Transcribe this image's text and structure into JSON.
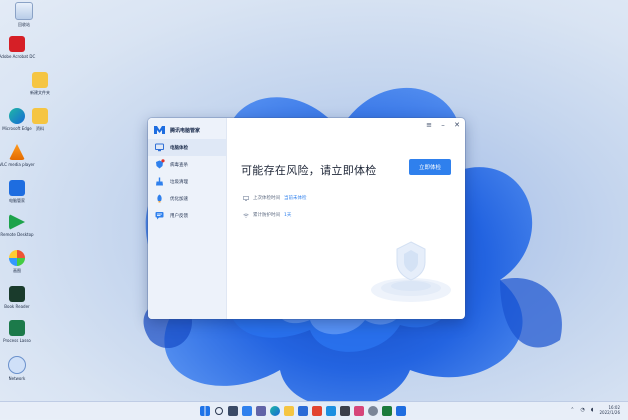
{
  "desktop": {
    "icons": [
      {
        "name": "recycle-bin",
        "label": "回收站"
      },
      {
        "name": "adobe-acrobat",
        "label": "Adobe Acrobat DC"
      },
      {
        "name": "folder",
        "label": "新建文件夹"
      },
      {
        "name": "microsoft-edge",
        "label": "Microsoft Edge"
      },
      {
        "name": "folder",
        "label": "资料"
      },
      {
        "name": "vlc-player",
        "label": "VLC media player"
      },
      {
        "name": "pc-manager",
        "label": "电脑管家"
      },
      {
        "name": "remote-desktop",
        "label": "Remote Desktop"
      },
      {
        "name": "drawing-app",
        "label": "画图"
      },
      {
        "name": "ebook-reader",
        "label": "Book Reader"
      },
      {
        "name": "performance-meter",
        "label": "Process Lasso"
      },
      {
        "name": "network-app",
        "label": "Network"
      }
    ]
  },
  "app": {
    "title": "腾讯电脑管家",
    "window_controls": {
      "menu": "≡",
      "minimize": "–",
      "close": "✕"
    },
    "nav": [
      {
        "label": "电脑体检",
        "icon": "monitor-icon",
        "active": true
      },
      {
        "label": "病毒查杀",
        "icon": "shield-virus-icon",
        "badge": true
      },
      {
        "label": "垃圾清理",
        "icon": "broom-icon"
      },
      {
        "label": "优化加速",
        "icon": "rocket-icon"
      },
      {
        "label": "用户反馈",
        "icon": "feedback-icon"
      }
    ],
    "headline": "可能存在风险，请立即体检",
    "cta_label": "立即体检",
    "info": [
      {
        "label": "上次体检时间",
        "value": "当前未体检",
        "icon": "monitor-icon"
      },
      {
        "label": "累计防护时间",
        "value": "1天",
        "icon": "wifi-icon"
      }
    ]
  },
  "taskbar": {
    "icons": [
      "windows-start-icon",
      "search-icon",
      "task-view-icon",
      "widgets-icon",
      "chat-icon",
      "edge-icon",
      "file-explorer-icon",
      "store-icon",
      "office-icon",
      "mail-icon",
      "photos-icon",
      "media-icon",
      "settings-icon",
      "terminal-icon",
      "pc-manager-taskbar-icon"
    ],
    "time": "16:02",
    "date": "2022/1/26"
  },
  "colors": {
    "accent": "#2f80ed",
    "sidebar": "#edf2fa",
    "badge": "#e0322c"
  }
}
